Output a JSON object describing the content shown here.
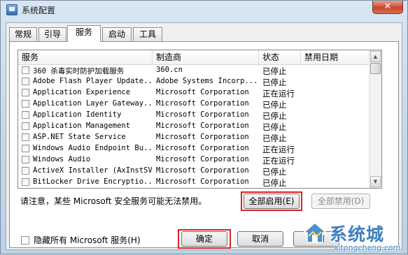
{
  "window": {
    "title": "系统配置",
    "close_glyph": "✕"
  },
  "tabs": [
    {
      "label": "常规",
      "active": false
    },
    {
      "label": "引导",
      "active": false
    },
    {
      "label": "服务",
      "active": true
    },
    {
      "label": "启动",
      "active": false
    },
    {
      "label": "工具",
      "active": false
    }
  ],
  "columns": [
    "服务",
    "制造商",
    "状态",
    "禁用日期"
  ],
  "services": [
    {
      "name": "360 杀毒实时防护加载服务",
      "maker": "360.cn",
      "status": "已停止",
      "checked": false
    },
    {
      "name": "Adobe Flash Player Update...",
      "maker": "Adobe Systems Incorp...",
      "status": "已停止",
      "checked": false
    },
    {
      "name": "Application Experience",
      "maker": "Microsoft Corporation",
      "status": "正在运行",
      "checked": false
    },
    {
      "name": "Application Layer Gateway...",
      "maker": "Microsoft Corporation",
      "status": "已停止",
      "checked": false
    },
    {
      "name": "Application Identity",
      "maker": "Microsoft Corporation",
      "status": "已停止",
      "checked": false
    },
    {
      "name": "Application Management",
      "maker": "Microsoft Corporation",
      "status": "已停止",
      "checked": false
    },
    {
      "name": "ASP.NET State Service",
      "maker": "Microsoft Corporation",
      "status": "已停止",
      "checked": false
    },
    {
      "name": "Windows Audio Endpoint Bu...",
      "maker": "Microsoft Corporation",
      "status": "正在运行",
      "checked": false
    },
    {
      "name": "Windows Audio",
      "maker": "Microsoft Corporation",
      "status": "正在运行",
      "checked": false
    },
    {
      "name": "ActiveX Installer (AxInstSV)",
      "maker": "Microsoft Corporation",
      "status": "已停止",
      "checked": false
    },
    {
      "name": "BitLocker Drive Encryptio...",
      "maker": "Microsoft Corporation",
      "status": "已停止",
      "checked": false
    }
  ],
  "note": "请注意，某些 Microsoft 安全服务可能无法禁用。",
  "buttons": {
    "enable_all": "全部启用(E)",
    "disable_all": "全部禁用(D)",
    "ok": "确定",
    "cancel": "取消",
    "apply": "应用"
  },
  "hide_ms": {
    "label": "隐藏所有 Microsoft 服务(H)",
    "checked": false
  },
  "watermark": {
    "brand": "系统城",
    "url": "xitongcheng.com"
  },
  "colors": {
    "highlight": "#d8232a",
    "brand": "#3f7fc0"
  }
}
